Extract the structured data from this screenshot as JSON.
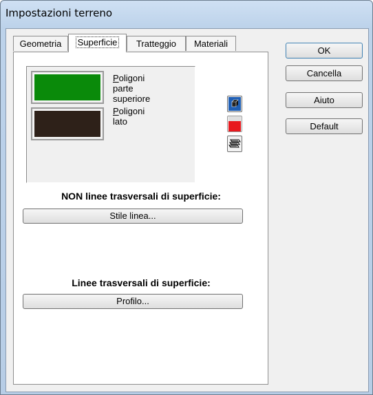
{
  "window": {
    "title": "Impostazioni terreno"
  },
  "tabs": [
    {
      "label": "Geometria",
      "active": false
    },
    {
      "label": "Superficie",
      "active": true
    },
    {
      "label": "Tratteggio",
      "active": false
    },
    {
      "label": "Materiali",
      "active": false
    }
  ],
  "surface": {
    "top_swatch": {
      "color": "#0a8a0a",
      "label_mnemonic": "P",
      "label_rest": "oligoni",
      "label_line2": "parte",
      "label_line3": "superiore"
    },
    "side_swatch": {
      "color": "#2e2119",
      "label_mnemonic": "P",
      "label_rest": "oligoni",
      "label_line2": "lato"
    },
    "side_buttons": [
      {
        "icon": "cube-solid-icon",
        "color": "#1f5fb5"
      },
      {
        "icon": "red-fill-icon",
        "color": "#e8191e"
      },
      {
        "icon": "layers-icon",
        "color": "#000000"
      }
    ]
  },
  "non_lines": {
    "title": "NON linee trasversali di superficie:",
    "button": "Stile linea..."
  },
  "lines": {
    "title": "Linee trasversali di superficie:",
    "button": "Profilo..."
  },
  "dialog_buttons": {
    "ok": "OK",
    "cancel": "Cancella",
    "help": "Aiuto",
    "default": "Default"
  }
}
